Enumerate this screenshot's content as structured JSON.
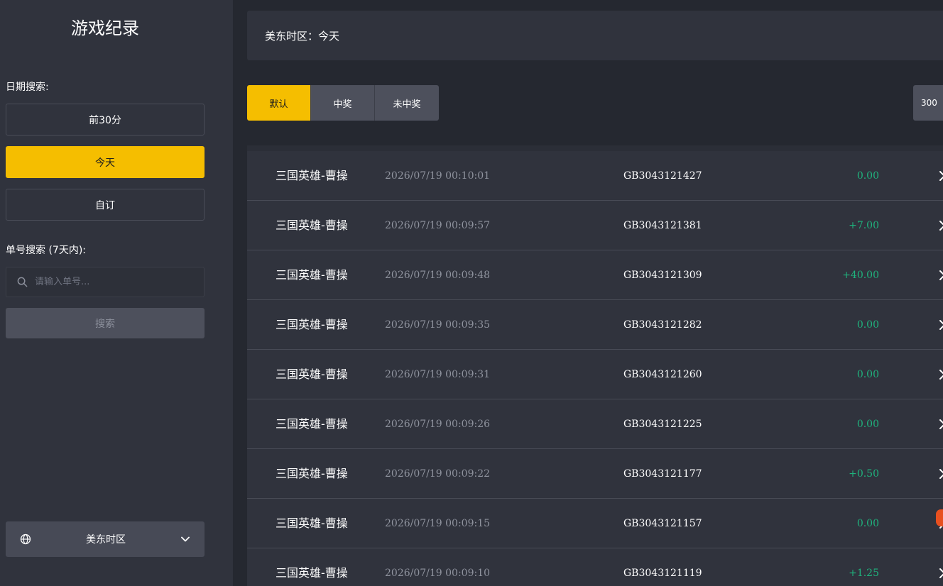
{
  "sidebar": {
    "title": "游戏纪录",
    "date_label": "日期搜索:",
    "date_options": [
      {
        "label": "前30分",
        "active": false
      },
      {
        "label": "今天",
        "active": true
      },
      {
        "label": "自订",
        "active": false
      }
    ],
    "order_label": "单号搜索 (7天内):",
    "search_placeholder": "请输入单号...",
    "search_button": "搜索",
    "timezone_select": "美东时区"
  },
  "banner": {
    "text": "美东时区：今天"
  },
  "filters": [
    {
      "label": "默认",
      "active": true
    },
    {
      "label": "中奖",
      "active": false
    },
    {
      "label": "未中奖",
      "active": false
    }
  ],
  "page_size": "300",
  "records": [
    {
      "game": "三国英雄-曹操",
      "time": "2026/07/19 00:10:01",
      "order": "GB3043121427",
      "amount": "0.00"
    },
    {
      "game": "三国英雄-曹操",
      "time": "2026/07/19 00:09:57",
      "order": "GB3043121381",
      "amount": "+7.00"
    },
    {
      "game": "三国英雄-曹操",
      "time": "2026/07/19 00:09:48",
      "order": "GB3043121309",
      "amount": "+40.00"
    },
    {
      "game": "三国英雄-曹操",
      "time": "2026/07/19 00:09:35",
      "order": "GB3043121282",
      "amount": "0.00"
    },
    {
      "game": "三国英雄-曹操",
      "time": "2026/07/19 00:09:31",
      "order": "GB3043121260",
      "amount": "0.00"
    },
    {
      "game": "三国英雄-曹操",
      "time": "2026/07/19 00:09:26",
      "order": "GB3043121225",
      "amount": "0.00"
    },
    {
      "game": "三国英雄-曹操",
      "time": "2026/07/19 00:09:22",
      "order": "GB3043121177",
      "amount": "+0.50"
    },
    {
      "game": "三国英雄-曹操",
      "time": "2026/07/19 00:09:15",
      "order": "GB3043121157",
      "amount": "0.00"
    },
    {
      "game": "三国英雄-曹操",
      "time": "2026/07/19 00:09:10",
      "order": "GB3043121119",
      "amount": "+1.25"
    }
  ],
  "colors": {
    "accent": "#f5be00",
    "positive": "#1fb37d",
    "sidebar_bg": "#30333d",
    "page_bg": "#252830"
  },
  "icons": {
    "search": "search-icon",
    "globe": "globe-icon",
    "dropdown": "chevron-down-icon",
    "row_detail": "chevron-right-icon"
  }
}
